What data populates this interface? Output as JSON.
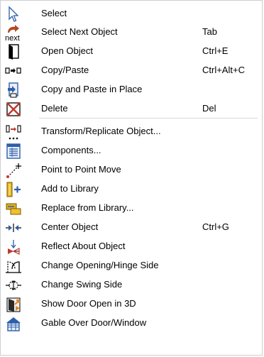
{
  "menu": {
    "group1": [
      {
        "label": "Select",
        "shortcut": "",
        "icon": "select-arrow-icon"
      },
      {
        "label": "Select Next Object",
        "shortcut": "Tab",
        "icon": "select-next-icon",
        "icon_text": "next"
      },
      {
        "label": "Open Object",
        "shortcut": "Ctrl+E",
        "icon": "open-object-icon"
      },
      {
        "label": "Copy/Paste",
        "shortcut": "Ctrl+Alt+C",
        "icon": "copy-paste-icon"
      },
      {
        "label": "Copy and Paste in Place",
        "shortcut": "",
        "icon": "copy-paste-in-place-icon"
      },
      {
        "label": "Delete",
        "shortcut": "Del",
        "icon": "delete-icon"
      }
    ],
    "group2": [
      {
        "label": "Transform/Replicate Object...",
        "shortcut": "",
        "icon": "transform-replicate-icon"
      },
      {
        "label": "Components...",
        "shortcut": "",
        "icon": "components-icon"
      },
      {
        "label": "Point to Point Move",
        "shortcut": "",
        "icon": "point-to-point-move-icon"
      },
      {
        "label": "Add to Library",
        "shortcut": "",
        "icon": "add-to-library-icon"
      },
      {
        "label": "Replace from Library...",
        "shortcut": "",
        "icon": "replace-from-library-icon"
      },
      {
        "label": "Center Object",
        "shortcut": "Ctrl+G",
        "icon": "center-object-icon"
      },
      {
        "label": "Reflect About Object",
        "shortcut": "",
        "icon": "reflect-icon"
      },
      {
        "label": "Change Opening/Hinge Side",
        "shortcut": "",
        "icon": "change-hinge-side-icon"
      },
      {
        "label": "Change Swing Side",
        "shortcut": "",
        "icon": "change-swing-side-icon"
      },
      {
        "label": "Show Door Open in 3D",
        "shortcut": "",
        "icon": "door-open-3d-icon"
      },
      {
        "label": "Gable Over Door/Window",
        "shortcut": "",
        "icon": "gable-icon"
      }
    ]
  },
  "colors": {
    "icon_blue": "#2d5fa8",
    "icon_red": "#c0392b",
    "icon_orange": "#e0862a",
    "separator": "#d8d8d8"
  }
}
